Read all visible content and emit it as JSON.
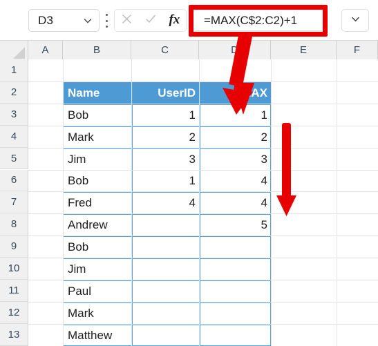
{
  "app": {
    "name": "spreadsheet-formula-bar-view"
  },
  "formula_bar": {
    "name_box_value": "D3",
    "name_box_chevron_icon": "chevron-down-icon",
    "more_options_icon": "kebab-menu-icon",
    "cancel_icon": "cancel-x-icon",
    "enter_icon": "confirm-check-icon",
    "insert_function_icon": "fx-icon",
    "insert_function_label": "fx",
    "formula_value": "=MAX(C$2:C2)+1",
    "formula_placeholder": "",
    "expand_icon": "chevron-down-icon",
    "highlight_color": "#e60000"
  },
  "grid": {
    "column_headers": [
      "A",
      "B",
      "C",
      "D",
      "E",
      "F"
    ],
    "row_headers": [
      "1",
      "2",
      "3",
      "4",
      "5",
      "6",
      "7",
      "8",
      "9",
      "10",
      "11",
      "12",
      "13"
    ],
    "select_all_icon": "select-all-corner-icon",
    "header_fill": "#f0f0f0",
    "header_text_color": "#33475b",
    "gridline_color": "#e3e3e3"
  },
  "table": {
    "accent_border": "#4ea5dc",
    "header_fill": "#4e9ad4",
    "header_text_color": "#ffffff",
    "columns": [
      "Name",
      "UserID",
      "MAX"
    ],
    "rows": [
      {
        "row": "3",
        "name": "Bob",
        "userid": "1",
        "max": "1"
      },
      {
        "row": "4",
        "name": "Mark",
        "userid": "2",
        "max": "2"
      },
      {
        "row": "5",
        "name": "Jim",
        "userid": "3",
        "max": "3"
      },
      {
        "row": "6",
        "name": "Bob",
        "userid": "1",
        "max": "4"
      },
      {
        "row": "7",
        "name": "Fred",
        "userid": "4",
        "max": "4"
      },
      {
        "row": "8",
        "name": "Andrew",
        "userid": "",
        "max": "5"
      },
      {
        "row": "9",
        "name": "Bob",
        "userid": "",
        "max": ""
      },
      {
        "row": "10",
        "name": "Jim",
        "userid": "",
        "max": ""
      },
      {
        "row": "11",
        "name": "Paul",
        "userid": "",
        "max": ""
      },
      {
        "row": "12",
        "name": "Mark",
        "userid": "",
        "max": ""
      },
      {
        "row": "13",
        "name": "Matthew",
        "userid": "",
        "max": ""
      }
    ]
  },
  "annotations": {
    "color": "#e60000",
    "arrow_formula_to_cell": "arrow-down-icon",
    "arrow_fill_down": "arrow-down-icon"
  }
}
